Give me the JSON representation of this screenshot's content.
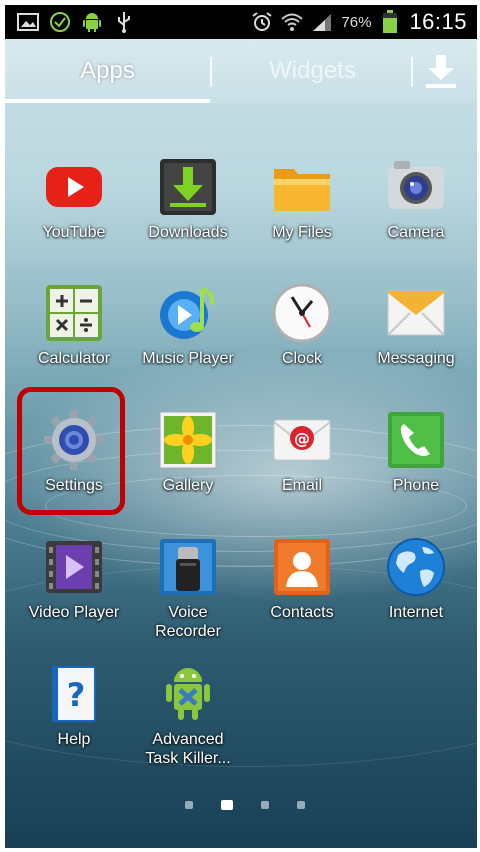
{
  "status_bar": {
    "left_icons": [
      "picture-icon",
      "check-circle-icon",
      "android-icon",
      "usb-icon"
    ],
    "right_icons": [
      "alarm-icon",
      "wifi-icon",
      "signal-icon",
      "battery-icon"
    ],
    "battery_percent": "76%",
    "time": "16:15"
  },
  "tabs": {
    "apps": "Apps",
    "widgets": "Widgets",
    "download_icon": "download-icon"
  },
  "apps": [
    {
      "label": "YouTube",
      "icon": "youtube-icon"
    },
    {
      "label": "Downloads",
      "icon": "downloads-icon"
    },
    {
      "label": "My Files",
      "icon": "folder-icon"
    },
    {
      "label": "Camera",
      "icon": "camera-icon"
    },
    {
      "label": "Calculator",
      "icon": "calculator-icon"
    },
    {
      "label": "Music Player",
      "icon": "music-icon"
    },
    {
      "label": "Clock",
      "icon": "clock-icon"
    },
    {
      "label": "Messaging",
      "icon": "envelope-icon"
    },
    {
      "label": "Settings",
      "icon": "gear-icon"
    },
    {
      "label": "Gallery",
      "icon": "gallery-icon"
    },
    {
      "label": "Email",
      "icon": "email-icon"
    },
    {
      "label": "Phone",
      "icon": "phone-icon"
    },
    {
      "label": "Video Player",
      "icon": "video-player-icon"
    },
    {
      "label": "Voice\nRecorder",
      "icon": "microphone-icon"
    },
    {
      "label": "Contacts",
      "icon": "contacts-icon"
    },
    {
      "label": "Internet",
      "icon": "globe-icon"
    },
    {
      "label": "Help",
      "icon": "help-book-icon"
    },
    {
      "label": "Advanced\nTask Killer...",
      "icon": "android-task-killer-icon"
    }
  ],
  "page_indicator": {
    "pages": 4,
    "active": 2
  },
  "highlight_color": "#c00000"
}
